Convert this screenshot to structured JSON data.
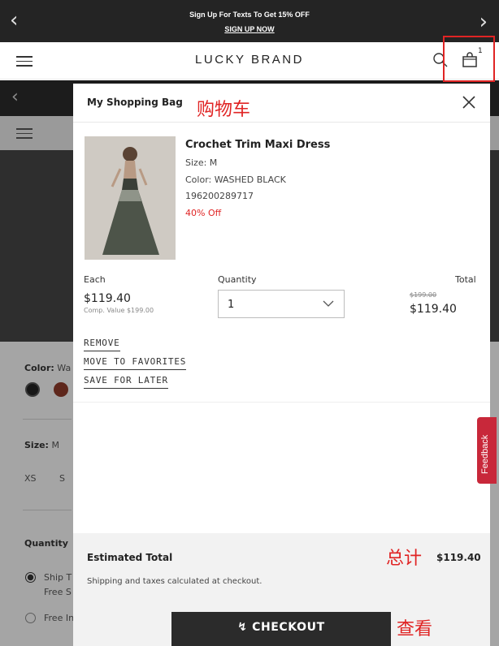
{
  "promo": {
    "message": "Sign Up For Texts To Get 15% OFF",
    "cta": "SIGN UP NOW"
  },
  "header": {
    "brand": "LUCKY BRAND",
    "bag_count": "1"
  },
  "background_page": {
    "color_label": "Color:",
    "color_value": "Wa",
    "size_label": "Size:",
    "size_value": "M",
    "size_options": [
      "XS",
      "S"
    ],
    "quantity_label": "Quantity",
    "shipping_option_1": "Ship T",
    "shipping_option_1b": "Free S",
    "shipping_option_2": "Free In"
  },
  "drawer": {
    "title": "My Shopping Bag",
    "title_annotation": "购物车",
    "product": {
      "name": "Crochet Trim Maxi Dress",
      "size": "Size: M",
      "color": "Color: WASHED BLACK",
      "sku": "196200289717",
      "discount": "40% Off"
    },
    "labels": {
      "each": "Each",
      "quantity": "Quantity",
      "total": "Total"
    },
    "each_price": "$119.40",
    "comp_value": "Comp. Value $199.00",
    "quantity_value": "1",
    "original_total": "$199.00",
    "line_total": "$119.40",
    "actions": {
      "remove": "REMOVE",
      "move_to_favorites": "MOVE TO FAVORITES",
      "save_for_later": "SAVE FOR LATER"
    },
    "feedback_tab": "Feedback",
    "summary": {
      "estimated_total_label": "Estimated Total",
      "total_annotation": "总计",
      "estimated_total_value": "$119.40",
      "shipping_note": "Shipping and taxes calculated at checkout.",
      "checkout_label": "CHECKOUT",
      "checkout_annotation": "查看"
    }
  },
  "colors": {
    "promo_bg": "#242424",
    "checkout_bg": "#2b2b2b",
    "discount_red": "#e02424",
    "feedback_red": "#c8283a",
    "annotation_red": "#e02424"
  }
}
